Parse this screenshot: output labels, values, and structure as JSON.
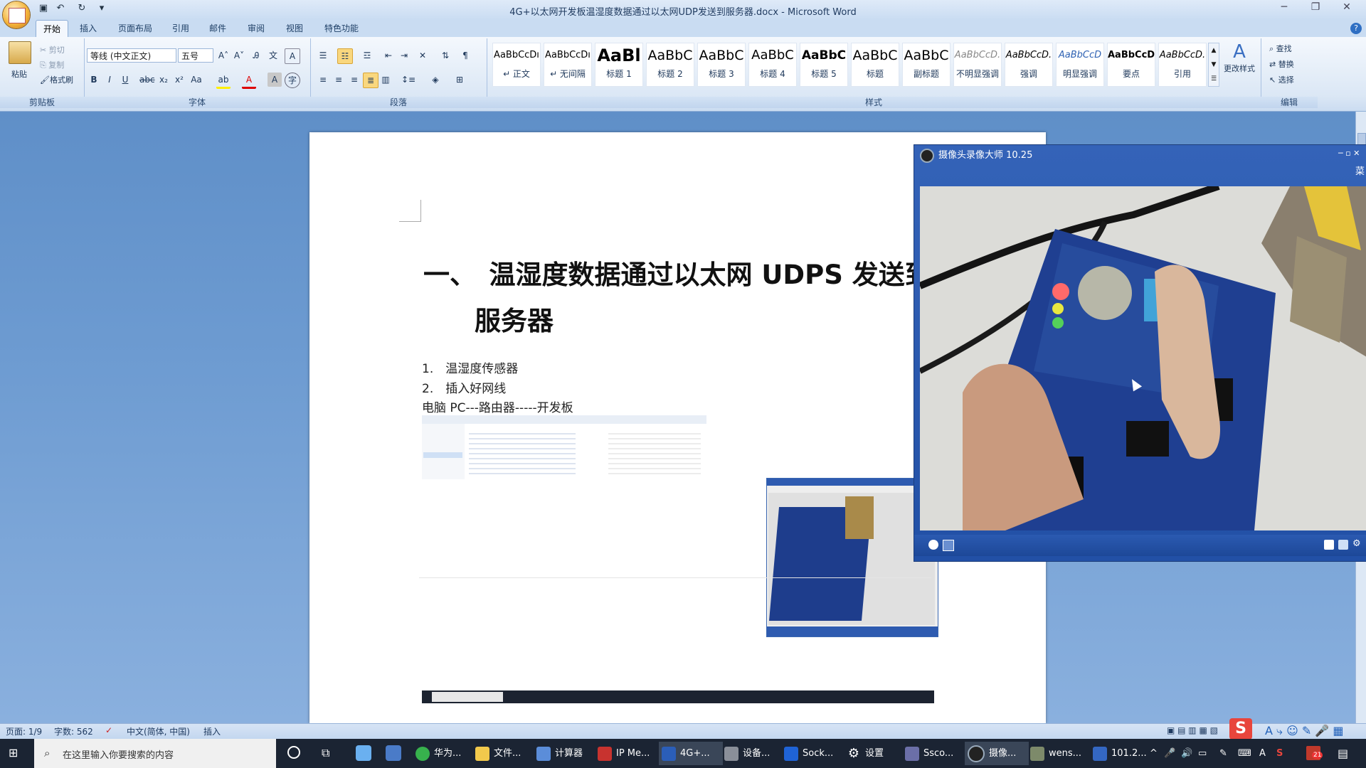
{
  "window": {
    "title": "4G+以太网开发板温湿度数据通过以太网UDP发送到服务器.docx - Microsoft Word"
  },
  "ribbon": {
    "tabs": [
      "开始",
      "插入",
      "页面布局",
      "引用",
      "邮件",
      "审阅",
      "视图",
      "特色功能"
    ],
    "clipboard": {
      "paste": "粘贴",
      "cut": "剪切",
      "copy": "复制",
      "format_painter": "格式刷",
      "group_label": "剪贴板"
    },
    "font": {
      "name": "等线 (中文正文)",
      "size": "五号",
      "group_label": "字体"
    },
    "paragraph": {
      "group_label": "段落"
    },
    "styles": {
      "group_label": "样式",
      "change_styles": "更改样式",
      "items": [
        {
          "sample": "AaBbCcDı",
          "name": "↵ 正文"
        },
        {
          "sample": "AaBbCcDı",
          "name": "↵ 无间隔"
        },
        {
          "sample": "AaBl",
          "name": "标题 1"
        },
        {
          "sample": "AaBbC",
          "name": "标题 2"
        },
        {
          "sample": "AaBbC",
          "name": "标题 3"
        },
        {
          "sample": "AaBbC",
          "name": "标题 4"
        },
        {
          "sample": "AaBbC",
          "name": "标题 5"
        },
        {
          "sample": "AaBbC",
          "name": "标题"
        },
        {
          "sample": "AaBbC",
          "name": "副标题"
        },
        {
          "sample": "AaBbCcD.",
          "name": "不明显强调"
        },
        {
          "sample": "AaBbCcD.",
          "name": "强调"
        },
        {
          "sample": "AaBbCcD",
          "name": "明显强调"
        },
        {
          "sample": "AaBbCcD",
          "name": "要点"
        },
        {
          "sample": "AaBbCcD.",
          "name": "引用"
        }
      ]
    },
    "editing": {
      "find": "查找",
      "replace": "替换",
      "select": "选择",
      "group_label": "编辑"
    }
  },
  "document": {
    "heading_line1": "一、　温湿度数据通过以太网 UDPS 发送到",
    "heading_line2": "服务器",
    "list": [
      "1.　温湿度传感器",
      "2.　插入好网线"
    ],
    "line3": "电脑 PC---路由器-----开发板"
  },
  "camera_window": {
    "title": "摄像头录像大师 10.25",
    "menu": "菜"
  },
  "statusbar": {
    "page": "页面: 1/9",
    "words": "字数: 562",
    "language": "中文(简体, 中国)",
    "mode": "插入"
  },
  "taskbar": {
    "search_placeholder": "在这里输入你要搜索的内容",
    "apps": [
      "华为...",
      "文件...",
      "计算器",
      "IP Me...",
      "4G+...",
      "设备...",
      "Sock...",
      "设置",
      "Ssco...",
      "摄像...",
      "wens...",
      "101.2..."
    ],
    "badge": "21"
  },
  "colors": {
    "ribbon_bg": "#dbe7f5",
    "doc_bg": "#6d9bd1",
    "taskbar": "#1b2433",
    "cam_title": "#2250a6"
  }
}
